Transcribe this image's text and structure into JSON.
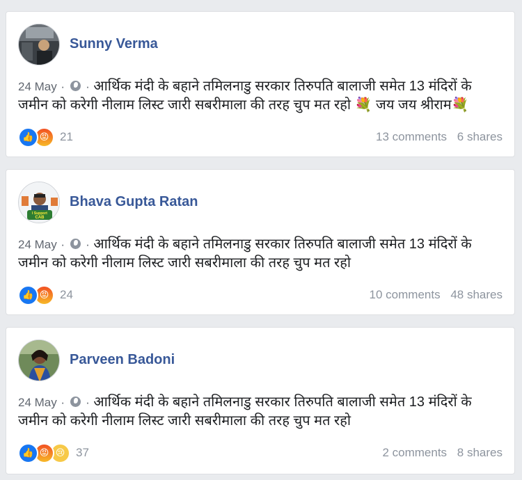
{
  "posts": [
    {
      "author": "Sunny Verma",
      "date": "24 May",
      "separator": "·",
      "text_line1": "आर्थिक मंदी के बहाने तमिलनाडु सरकार तिरुपति बालाजी समेत 13 मंदिरों के",
      "text_line2": "जमीन को करेगी नीलाम लिस्ट जारी सबरीमाला की तरह चुप मत रहो",
      "suffix_emoji": "💐",
      "suffix_text": "जय जय श्रीराम",
      "suffix_emoji2": "💐",
      "reactions": [
        "like-icon",
        "angry-icon"
      ],
      "reaction_count": "21",
      "comments": "13 comments",
      "shares": "6 shares"
    },
    {
      "author": "Bhava Gupta Ratan",
      "date": "24 May",
      "separator": "·",
      "text_line1": "आर्थिक मंदी के बहाने तमिलनाडु सरकार तिरुपति बालाजी समेत 13 मंदिरों के",
      "text_line2": "जमीन को करेगी नीलाम लिस्ट जारी सबरीमाला की तरह चुप मत रहो",
      "avatar_badge": "I Support CAB",
      "reactions": [
        "like-icon",
        "angry-icon"
      ],
      "reaction_count": "24",
      "comments": "10 comments",
      "shares": "48 shares"
    },
    {
      "author": "Parveen Badoni",
      "date": "24 May",
      "separator": "·",
      "text_line1": "आर्थिक मंदी के बहाने तमिलनाडु सरकार तिरुपति बालाजी समेत 13 मंदिरों के",
      "text_line2": "जमीन को करेगी नीलाम लिस्ट जारी सबरीमाला की तरह चुप मत रहो",
      "reactions": [
        "like-icon",
        "angry-icon",
        "sad-icon"
      ],
      "reaction_count": "37",
      "comments": "2 comments",
      "shares": "8 shares"
    }
  ],
  "colors": {
    "author_link": "#385898",
    "meta_gray": "#8d949e",
    "like_blue": "#1877f2"
  }
}
